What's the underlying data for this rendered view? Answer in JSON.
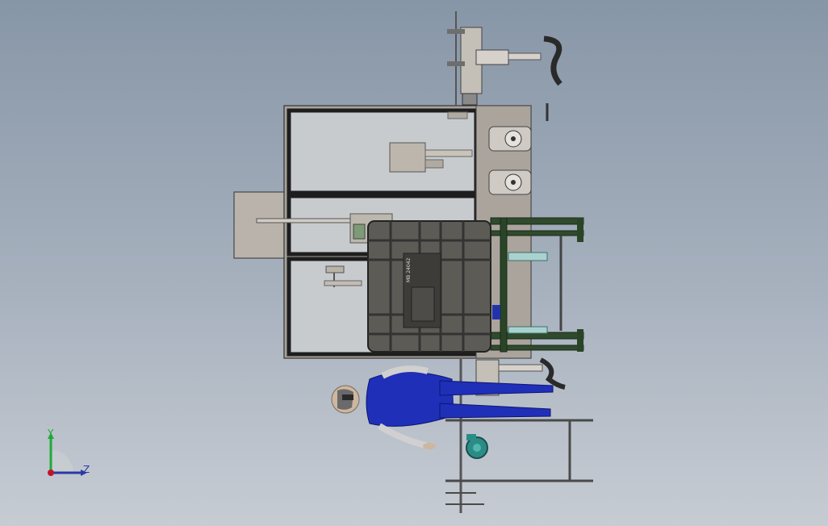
{
  "viewport": {
    "background_top": "#8796a7",
    "background_bottom": "#c7ccd3"
  },
  "model": {
    "tank_label": "MB 24042"
  },
  "triad": {
    "y_label": "Y",
    "z_label": "Z",
    "y_color": "#1faa3a",
    "z_color": "#2a3aa8",
    "origin_color": "#c0142a"
  }
}
